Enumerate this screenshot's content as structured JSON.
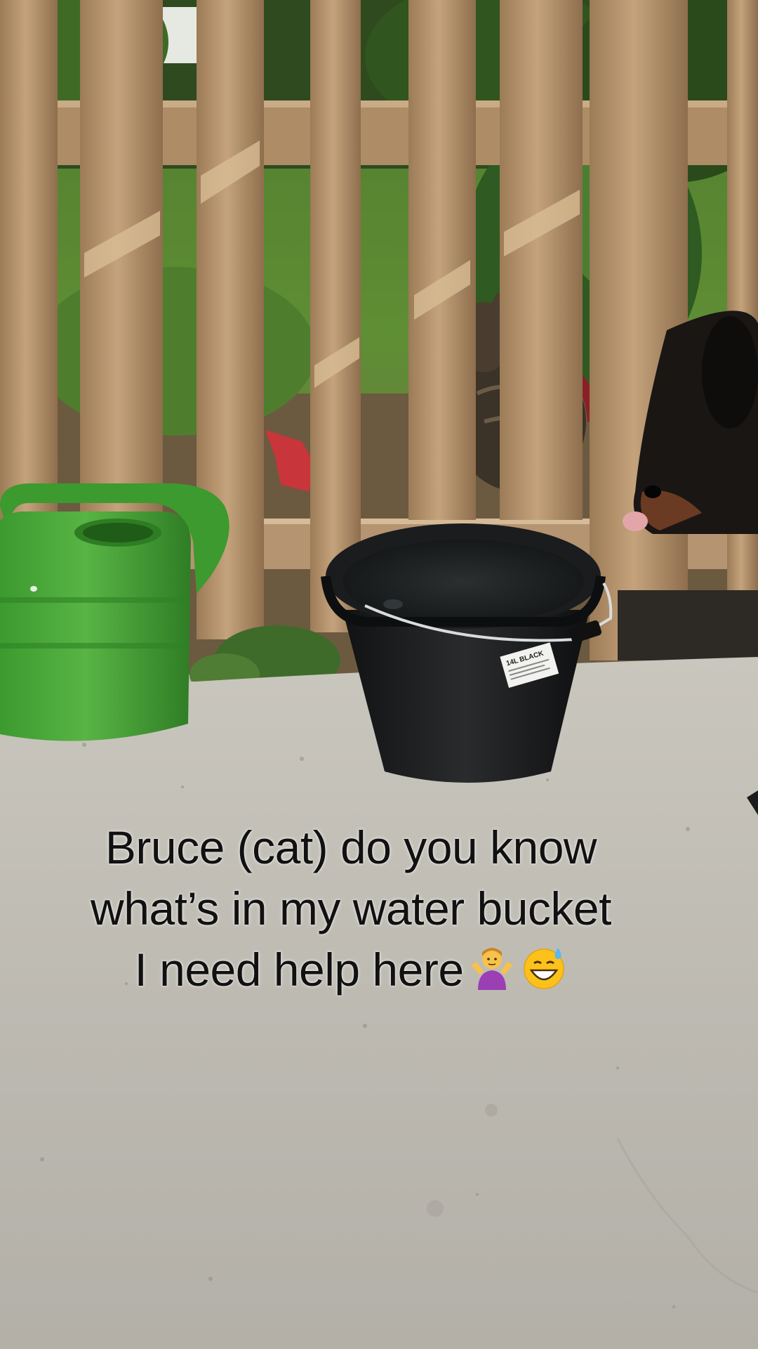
{
  "caption": {
    "line1": "Bruce (cat) do you know",
    "line2": "what’s in my water bucket",
    "line3": "I need help here",
    "emojis": [
      "person-shrugging-icon",
      "grinning-face-with-sweat-icon"
    ]
  },
  "bucket_label": "14L BLACK",
  "colors": {
    "caption_text": "#111111",
    "watering_can": "#4aa43a",
    "bucket": "#1d1e1f",
    "concrete": "#bdbab2",
    "fence": "#b2906a"
  }
}
